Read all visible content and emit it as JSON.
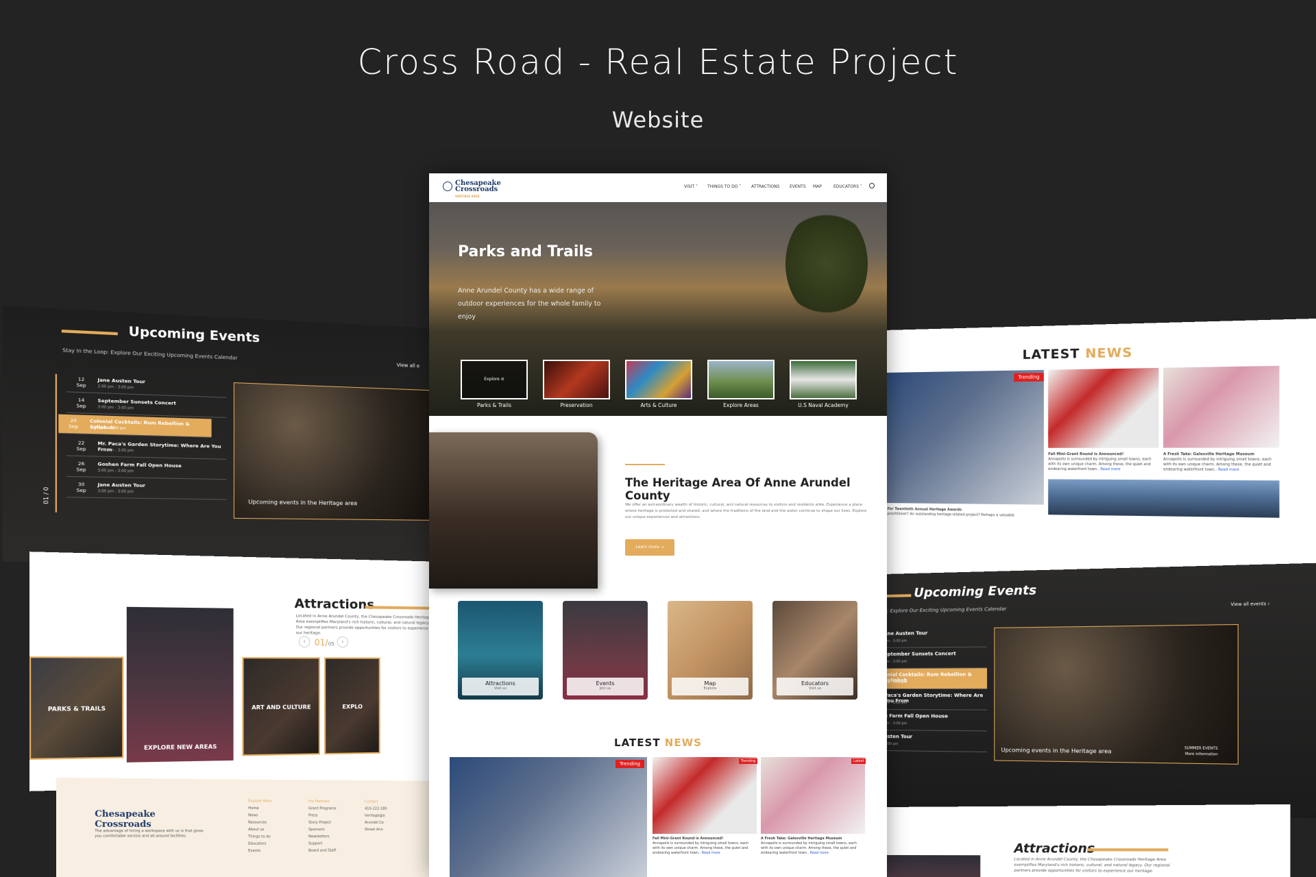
{
  "header": {
    "title": "Cross Road - Real Estate Project",
    "subtitle": "Website"
  },
  "site": {
    "logo_line1": "Chesapeake",
    "logo_line2": "Crossroads",
    "logo_line3": "HERITAGE AREA",
    "nav": [
      "VISIT",
      "THINGS TO DO",
      "ATTRACTIONS",
      "EVENTS",
      "MAP",
      "EDUCATORS"
    ],
    "hero": {
      "title": "Parks and Trails",
      "description": "Anne Arundel County has a wide range of outdoor experiences for the whole family to enjoy",
      "explore_label": "Explore",
      "thumbs": [
        "Parks & Trails",
        "Preservation",
        "Arts & Culture",
        "Explore Areas",
        "U.S Naval Academy"
      ]
    },
    "about": {
      "title": "The Heritage Area Of Anne Arundel County",
      "description": "We offer an extraordinary wealth of historic, cultural, and natural resources to visitors and residents alike. Experience a place where heritage is protected and shared, and where the traditions of the land and the water continue to shape our lives. Explore our unique experiences and attractions.",
      "button": "Learn more"
    },
    "cards": [
      {
        "title": "Attractions",
        "sub": "Visit us"
      },
      {
        "title": "Events",
        "sub": "Join us"
      },
      {
        "title": "Map",
        "sub": "Explore"
      },
      {
        "title": "Educators",
        "sub": "Visit us"
      }
    ],
    "news": {
      "title_a": "LATEST",
      "title_b": "NEWS",
      "badges": [
        "Trending",
        "Trending",
        "Latest"
      ],
      "items": [
        {
          "title": "Fall Mini-Grant Round is Announced!",
          "text": "Annapolis is surrounded by intriguing small towns, each with its own unique charm. Among these, the quiet and endearing waterfront town..",
          "more": "Read more"
        },
        {
          "title": "A Fresh Take: Galesville Heritage Museum",
          "text": "Annapolis is surrounded by intriguing small towns, each with its own unique charm. Among these, the quiet and endearing waterfront town..",
          "more": "Read more"
        }
      ],
      "extra_title": "s For Twentieth Annual Heritage Awards",
      "extra_text": "e practitioner? An outstanding heritage-related project? Perhaps a valuable"
    },
    "events": {
      "title": "Upcoming Events",
      "subtitle": "Stay In the Loop: Explore Our Exciting Upcoming Events Calendar",
      "right_subtitle": "y: Explore Our Exciting Upcoming Events Calendar",
      "view_all": "View all events",
      "view_all_short": "View all e",
      "caption": "Upcoming events in the Heritage area",
      "summer": "SUMMER EVENTS",
      "more_info": "More information",
      "side_date": "01 / 0",
      "rows": [
        {
          "day": "12",
          "mon": "Sep",
          "name": "Jane Austen Tour",
          "time": "2:00 pm - 3:00 pm"
        },
        {
          "day": "14",
          "mon": "Sep",
          "name": "September Sunsets Concert",
          "time": "3:00 pm - 3:00 pm"
        },
        {
          "day": "20",
          "mon": "Sep",
          "name": "Colonial Cocktails: Rum Rebellion & Syllabub",
          "time": "3:00 pm - 3:00 pm"
        },
        {
          "day": "22",
          "mon": "Sep",
          "name": "Mr. Paca's Garden Storytime: Where Are You From",
          "time": "2:00 pm - 3:00 pm"
        },
        {
          "day": "26",
          "mon": "Sep",
          "name": "Goshen Farm Fall Open House",
          "time": "3:00 pm - 3:00 pm"
        },
        {
          "day": "30",
          "mon": "Sep",
          "name": "Jane Austen Tour",
          "time": "3:00 pm - 3:00 pm"
        }
      ],
      "right_rows": [
        {
          "name": "ane Austen Tour",
          "time": "pm - 3:00 pm"
        },
        {
          "name": "eptember Sunsets Concert",
          "time": "pm - 3:00 pm"
        },
        {
          "name": "onial Cocktails: Rum Rebellion & Syllabub",
          "time": "pm - 3:00 pm"
        },
        {
          "name": "Paca's Garden Storytime: Where Are You From",
          "time": "pm - 3:00 pm"
        },
        {
          "name": "n Farm Fall Open House",
          "time": "pm - 3:00 pm"
        },
        {
          "name": "usten Tour",
          "time": "3:00 pm"
        }
      ]
    },
    "attractions": {
      "title": "Attractions",
      "description": "Located in Anne Arundel County, the Chesapeake Crossroads Heritage Area exemplifies Maryland's rich historic, cultural, and natural legacy. Our regional partners provide opportunities for visitors to experience our heritage.",
      "page_current": "01",
      "page_total": "05",
      "cards": [
        "PARKS & TRAILS",
        "EXPLORE NEW AREAS",
        "ART AND CULTURE",
        "EXPLO"
      ]
    },
    "footer": {
      "description": "The advantage of hiring a workspace with us is that gives you comfortable service and all-around facilities.",
      "col1_title": "Explore More",
      "col1": [
        "Home",
        "News",
        "Resources",
        "About us",
        "Things to do",
        "Educators",
        "Events"
      ],
      "col2_title": "For Partners",
      "col2": [
        "Grant Programs",
        "Press",
        "Story Project",
        "Sponsors",
        "Newsletters",
        "Support",
        "Board and Staff"
      ],
      "col3_title": "Contact",
      "col3": [
        "410-222-180",
        "heritage@a",
        "Arundel Ce",
        "Street Ann"
      ]
    }
  }
}
